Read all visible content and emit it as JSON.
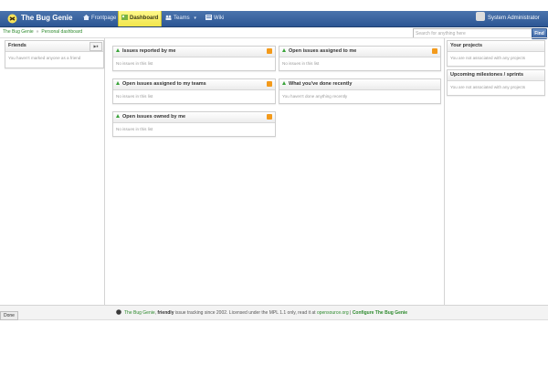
{
  "header": {
    "app_title": "The Bug Genie",
    "nav": {
      "frontpage": "Frontpage",
      "dashboard": "Dashboard",
      "teams": "Teams",
      "wiki": "Wiki"
    },
    "user_name": "System Administrator"
  },
  "breadcrumb": {
    "root": "The Bug Genie",
    "current": "Personal dashboard"
  },
  "search": {
    "placeholder": "Search for anything here",
    "find_label": "Find"
  },
  "left_panel": {
    "friends_title": "Friends",
    "friends_empty": "You haven't marked anyone as a friend"
  },
  "dashboard": {
    "issues_reported_title": "Issues reported by me",
    "issues_reported_empty": "No issues in this list",
    "open_assigned_title": "Open issues assigned to me",
    "open_assigned_empty": "No issues in this list",
    "open_teams_title": "Open issues assigned to my teams",
    "open_teams_empty": "No issues in this list",
    "recent_title": "What you've done recently",
    "recent_empty": "You haven't done anything recently",
    "open_owned_title": "Open issues owned by me",
    "open_owned_empty": "No issues in this list"
  },
  "right_panel": {
    "projects_title": "Your projects",
    "projects_empty": "You are not associated with any projects",
    "milestones_title": "Upcoming milestones / sprints",
    "milestones_empty": "You are not associated with any projects"
  },
  "footer": {
    "brand": "The Bug Genie",
    "friendly": "friendly",
    "text_mid": "issue tracking since 2002. Licensed under the MPL 1.1 only, read it at",
    "link_opensource": "opensource.org",
    "separator": "|",
    "configure": "Configure The Bug Genie"
  },
  "status_bar": {
    "done": "Done"
  },
  "colors": {
    "topbar": "#2c5694",
    "active_tab": "#f1e54a",
    "link_green": "#2d8a2d",
    "rss_orange": "#f39a1b"
  }
}
